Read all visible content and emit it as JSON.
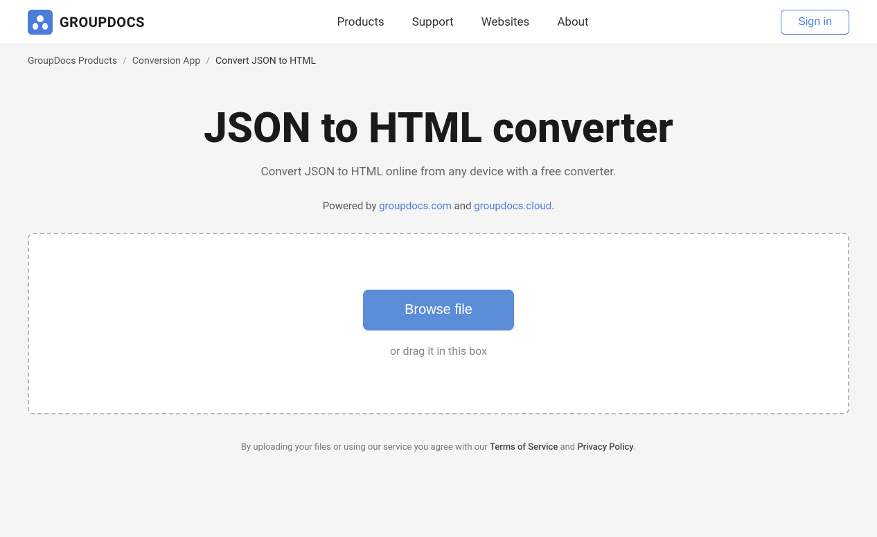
{
  "header": {
    "logo_text": "GROUPDOCS",
    "nav_items": [
      {
        "label": "Products",
        "href": "#"
      },
      {
        "label": "Support",
        "href": "#"
      },
      {
        "label": "Websites",
        "href": "#"
      },
      {
        "label": "About",
        "href": "#"
      }
    ],
    "signin_label": "Sign in"
  },
  "breadcrumb": {
    "items": [
      {
        "label": "GroupDocs Products",
        "href": "#"
      },
      {
        "label": "Conversion App",
        "href": "#"
      },
      {
        "label": "Convert JSON to HTML",
        "href": null
      }
    ],
    "separator": "/"
  },
  "main": {
    "title": "JSON to HTML converter",
    "subtitle": "Convert JSON to HTML online from any device with a free converter.",
    "powered_by_prefix": "Powered by ",
    "powered_by_link1_text": "groupdocs.com",
    "powered_by_link1_href": "#",
    "powered_by_middle": " and ",
    "powered_by_link2_text": "groupdocs.cloud",
    "powered_by_link2_href": "#",
    "powered_by_suffix": ".",
    "browse_btn_label": "Browse file",
    "drag_text": "or drag it in this box"
  },
  "footer_note": {
    "prefix": "By uploading your files or using our service you agree with our ",
    "tos_label": "Terms of Service",
    "tos_href": "#",
    "middle": " and ",
    "privacy_label": "Privacy Policy",
    "privacy_href": "#",
    "suffix": "."
  }
}
